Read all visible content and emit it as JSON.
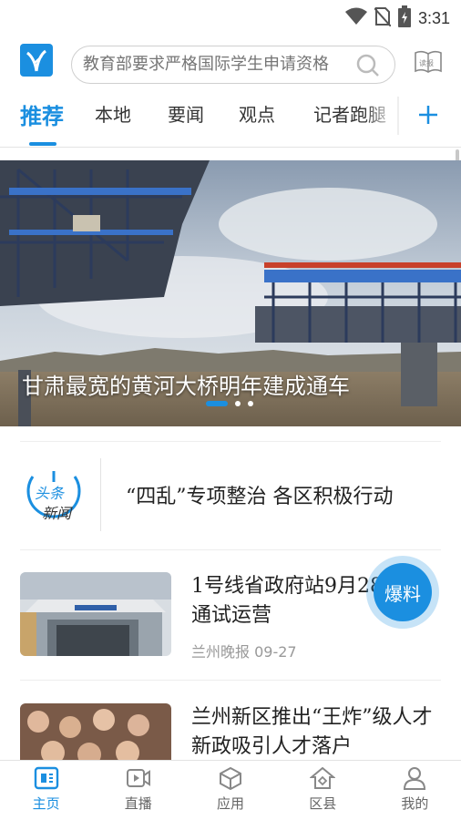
{
  "status_bar": {
    "time": "3:31"
  },
  "header": {
    "search_placeholder": "教育部要求严格国际学生申请资格",
    "paper_label": "读报"
  },
  "tabs": [
    {
      "label": "推荐",
      "active": true
    },
    {
      "label": "本地"
    },
    {
      "label": "要闻"
    },
    {
      "label": "观点"
    },
    {
      "label": "记者跑腿"
    }
  ],
  "banner": {
    "caption": "甘肃最宽的黄河大桥明年建成通车",
    "slide_count": 3,
    "active_slide": 1
  },
  "headline": {
    "logo_text": [
      "头条",
      "新闻"
    ],
    "text": "“四乱”专项整治 各区积极行动"
  },
  "news": [
    {
      "title": "1号线省政府站9月28日开通试运营",
      "source": "兰州晚报",
      "date": "09-27"
    },
    {
      "title": "兰州新区推出“王炸”级人才新政吸引人才落户"
    }
  ],
  "fab": {
    "label": "爆料"
  },
  "bottom_nav": [
    {
      "label": "主页",
      "icon": "home-icon",
      "active": true
    },
    {
      "label": "直播",
      "icon": "live-icon"
    },
    {
      "label": "应用",
      "icon": "apps-icon"
    },
    {
      "label": "区县",
      "icon": "district-icon"
    },
    {
      "label": "我的",
      "icon": "profile-icon"
    }
  ],
  "colors": {
    "accent": "#1b8fe0"
  }
}
